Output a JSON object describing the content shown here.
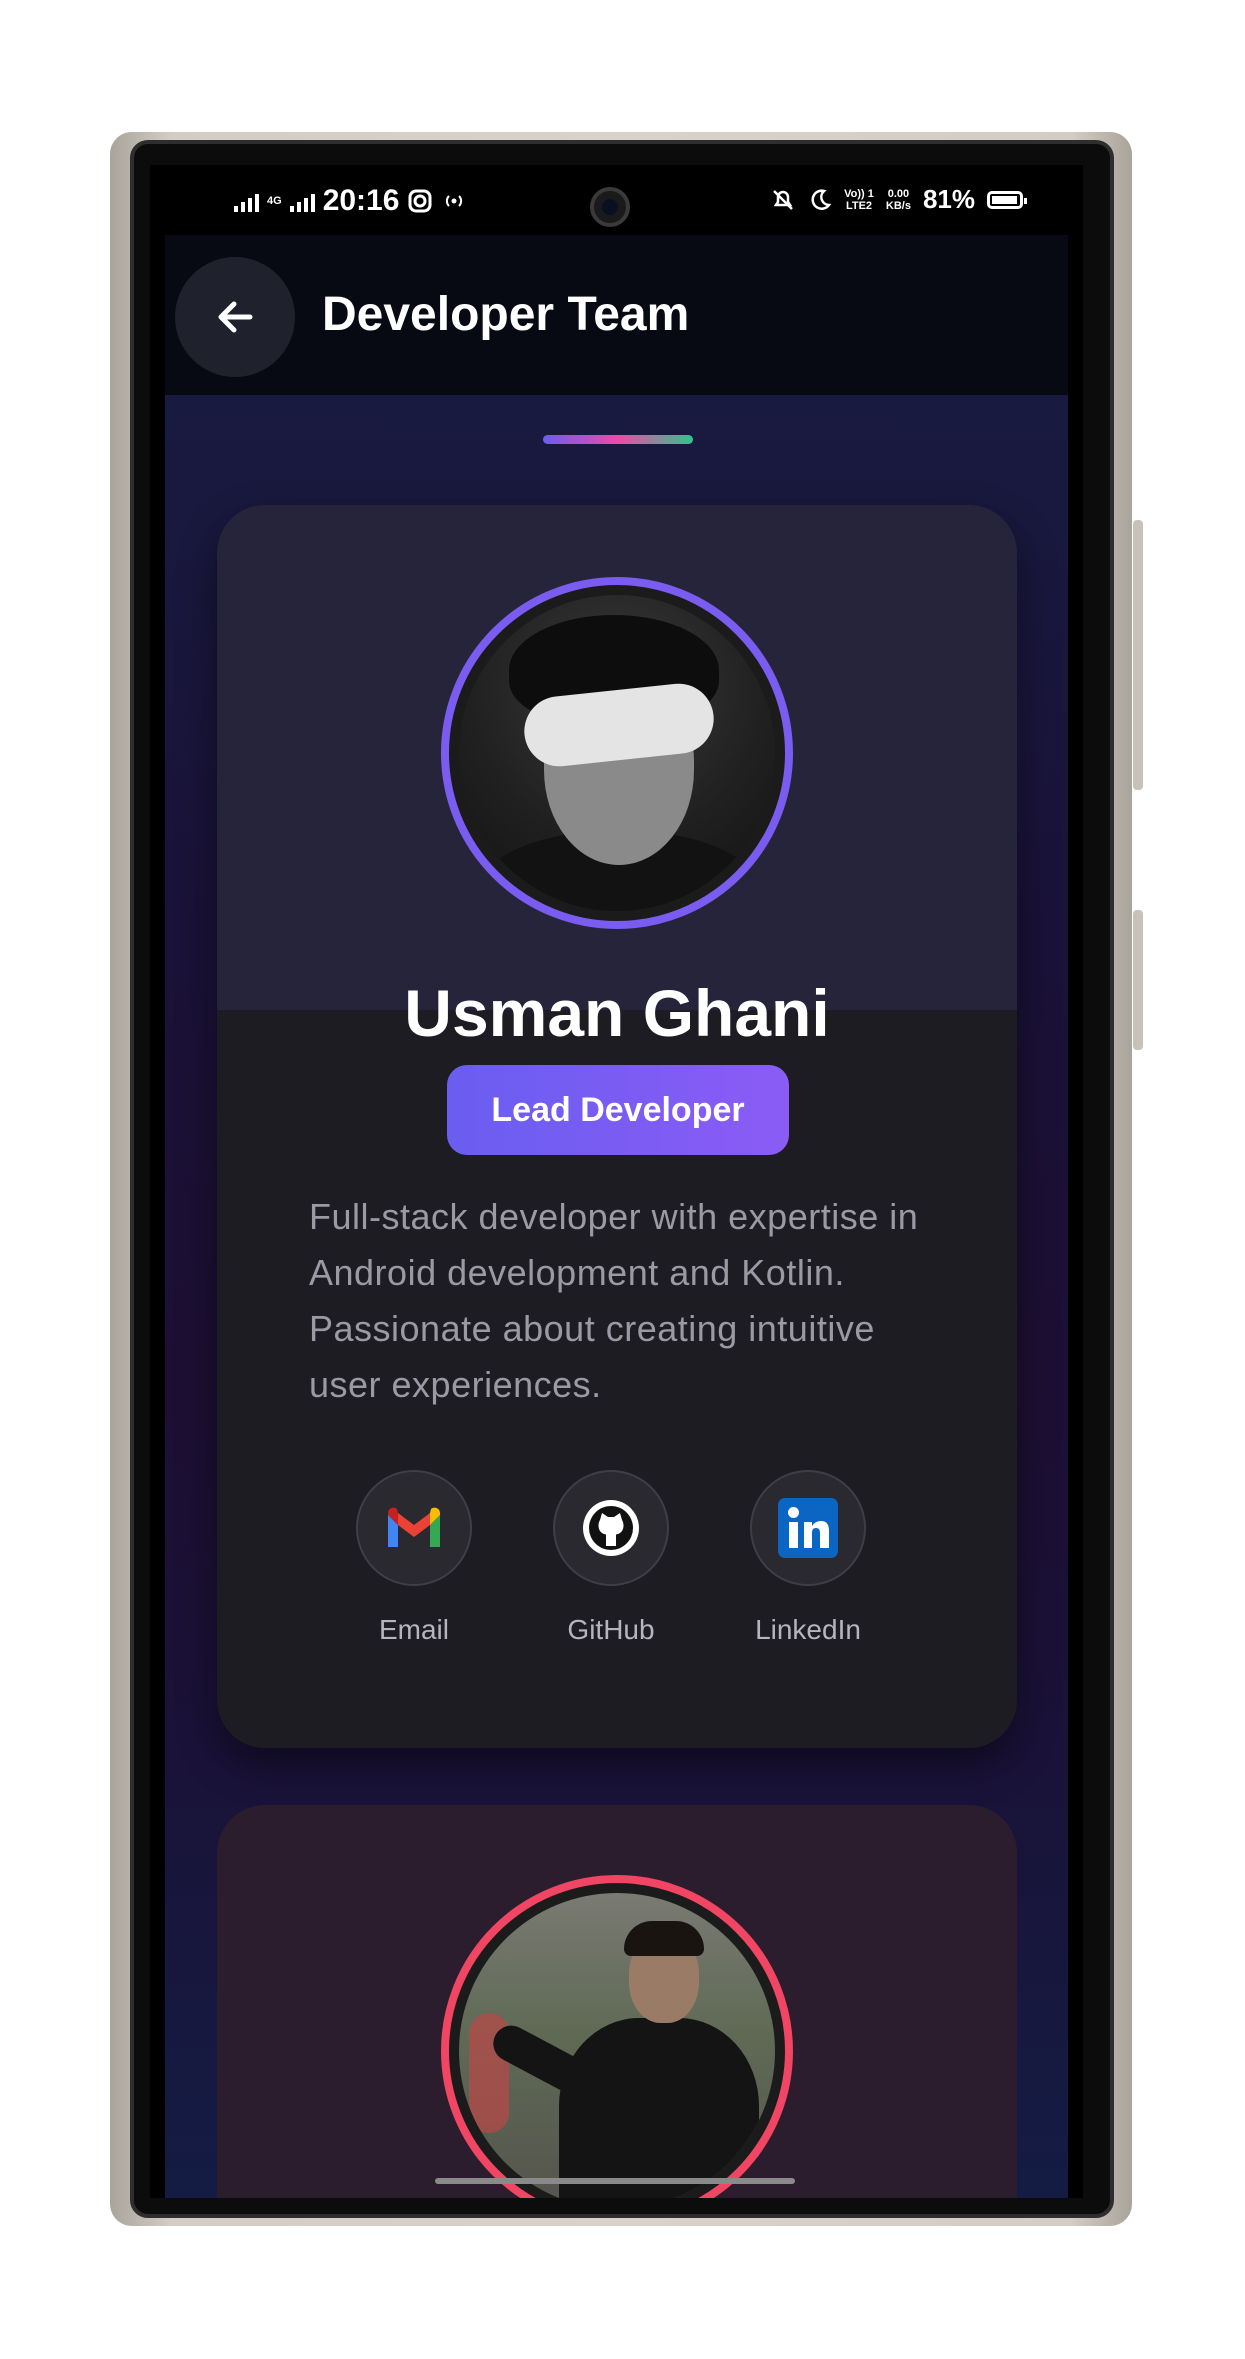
{
  "status_bar": {
    "network": "4G",
    "time": "20:16",
    "volte": "Vo)) 1",
    "lte": "LTE2",
    "data_speed": "0.00",
    "data_unit": "KB/s",
    "battery": "81%"
  },
  "app_bar": {
    "title": "Developer Team",
    "back_icon": "arrow-left-icon"
  },
  "developers": [
    {
      "name": "Usman Ghani",
      "role": "Lead Developer",
      "bio": "Full-stack developer with expertise in Android development and Kotlin. Passionate about creating intuitive user experiences.",
      "ring_color": "#7a5cf0",
      "links": [
        {
          "label": "Email",
          "icon": "gmail-icon"
        },
        {
          "label": "GitHub",
          "icon": "github-icon"
        },
        {
          "label": "LinkedIn",
          "icon": "linkedin-icon"
        }
      ]
    },
    {
      "ring_color": "#f04663"
    }
  ],
  "colors": {
    "accent_purple": "#6a5df0",
    "accent_pink": "#ec4ba6",
    "accent_green": "#2fc48f",
    "card_bg": "#1d1c22"
  }
}
